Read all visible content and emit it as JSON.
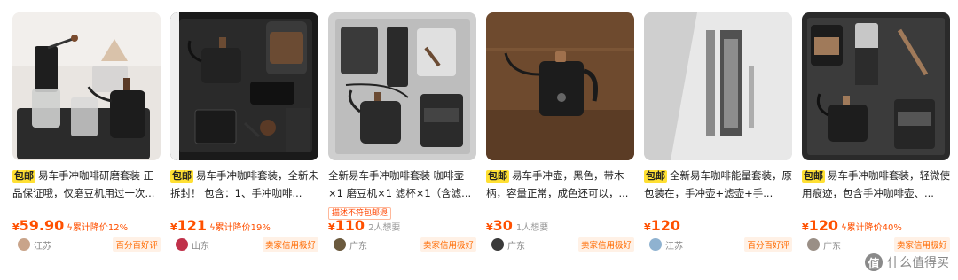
{
  "listings": [
    {
      "tag": "包邮",
      "title": "易车手冲咖啡研磨套装 正品保证哦，仅磨豆机用过一次...",
      "notice": "",
      "currency": "¥",
      "price": "59.90",
      "drop": "累计降价12%",
      "want": "",
      "region": "江苏",
      "badge": "百分百好评",
      "icons": {
        "drop": "lightning-icon"
      },
      "avatar_color": "#c9a48a"
    },
    {
      "tag": "包邮",
      "title": "易车手冲咖啡套装，全新未拆封！ 包含：1、手冲咖啡...",
      "notice": "",
      "currency": "¥",
      "price": "121",
      "drop": "累计降价19%",
      "want": "",
      "region": "山东",
      "badge": "卖家信用极好",
      "icons": {
        "drop": "lightning-icon"
      },
      "avatar_color": "#c0314a"
    },
    {
      "tag": "",
      "title": "全新易车手冲咖啡套装 咖啡壶×1 磨豆机×1 滤杯×1（含滤...",
      "notice": "描述不符包邮退",
      "currency": "¥",
      "price": "110",
      "drop": "",
      "want": "2人想要",
      "region": "广东",
      "badge": "卖家信用极好",
      "icons": {
        "drop": ""
      },
      "avatar_color": "#6b5a3e"
    },
    {
      "tag": "包邮",
      "title": "易车手冲壶，黑色，带木柄，容量正常，成色还可以，...",
      "notice": "",
      "currency": "¥",
      "price": "30",
      "drop": "",
      "want": "1人想要",
      "region": "广东",
      "badge": "卖家信用极好",
      "icons": {
        "drop": ""
      },
      "avatar_color": "#3a3a3a"
    },
    {
      "tag": "包邮",
      "title": "全新易车咖啡能量套装，原包装在，手冲壶+滤壶+手...",
      "notice": "",
      "currency": "¥",
      "price": "120",
      "drop": "",
      "want": "",
      "region": "江苏",
      "badge": "百分百好评",
      "icons": {
        "drop": ""
      },
      "avatar_color": "#8fb2d0"
    },
    {
      "tag": "包邮",
      "title": "易车手冲咖啡套装，轻微使用痕迹，包含手冲咖啡壶、...",
      "notice": "",
      "currency": "¥",
      "price": "120",
      "drop": "累计降价40%",
      "want": "",
      "region": "广东",
      "badge": "卖家信用极好",
      "icons": {
        "drop": "lightning-icon"
      },
      "avatar_color": "#9a8f86"
    }
  ],
  "watermark": {
    "icon_char": "值",
    "text": "什么值得买"
  },
  "colors": {
    "price": "#ff5000",
    "tag_bg": "#ffe033",
    "badge_text": "#ff6a00",
    "badge_bg": "#fff1e6"
  }
}
